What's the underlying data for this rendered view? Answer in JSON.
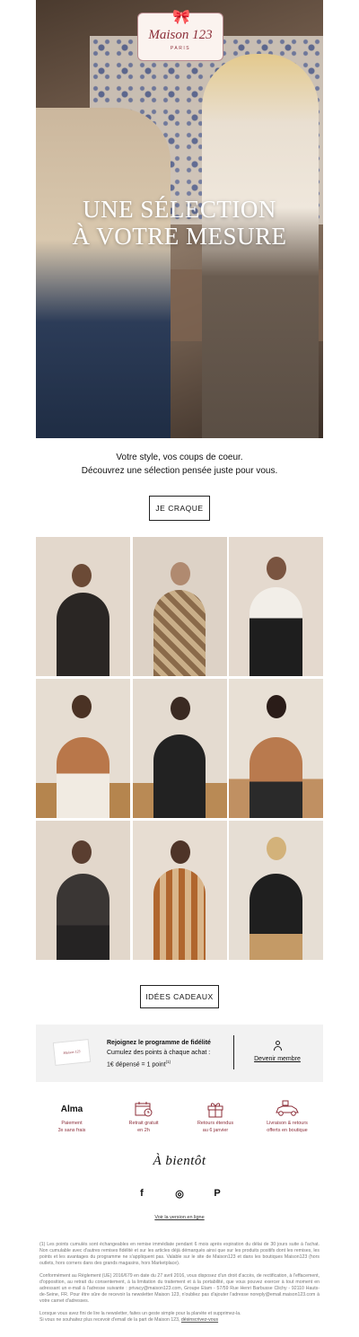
{
  "brand": {
    "name": "Maison 123",
    "city": "PARIS"
  },
  "hero": {
    "title_line1": "UNE SÉLECTION",
    "title_line2": "À VOTRE MESURE"
  },
  "intro": {
    "line1": "Votre style, vos coups de coeur.",
    "line2": "Découvrez une sélection pensée juste pour vous."
  },
  "cta_primary": "JE CRAQUE",
  "cta_secondary": "IDÉES CADEAUX",
  "loyalty": {
    "title": "Rejoignez le programme de fidélité",
    "line1": "Cumulez des points à chaque achat :",
    "line2": "1€ dépensé = 1 point",
    "footnote_mark": "(1)",
    "link": "Devenir membre"
  },
  "services": [
    {
      "icon": "alma-logo",
      "logo_text": "Alma",
      "line1": "Paiement",
      "line2": "3x sans frais"
    },
    {
      "icon": "calendar-clock-icon",
      "line1": "Retrait gratuit",
      "line2": "en 2h"
    },
    {
      "icon": "gift-icon",
      "line1": "Retours étendus",
      "line2": "au 6 janvier"
    },
    {
      "icon": "car-gift-icon",
      "line1": "Livraison & retours",
      "line2": "offerts en boutique"
    }
  ],
  "signoff": "À bientôt",
  "social": [
    {
      "icon": "facebook-icon",
      "glyph": "f"
    },
    {
      "icon": "instagram-icon",
      "glyph": "◎"
    },
    {
      "icon": "pinterest-icon",
      "glyph": "P"
    }
  ],
  "online_link": "Voir la version en ligne",
  "legal": {
    "p1": "(1) Les points cumulés sont échangeables en remise immédiate pendant 6 mois après expiration du délai de 30 jours suite à l'achat. Non cumulable avec d'autres remises fidélité et sur les articles déjà démarqués ainsi que sur les produits positifs dont les remises, les points et les avantages du programme ne s'appliquent pas. Valable sur le site de Maison123 et dans les boutiques Maison123 (hors outlets, hors corners dans des grands magasins, hors Marketplace).",
    "p2": "Conformément au Règlement (UE) 2016/679 en date du 27 avril 2016, vous disposez d'un droit d'accès, de rectification, à l'effacement, d'opposition, au retrait du consentement, à la limitation du traitement et à la portabilité, que vous pouvez exercer à tout moment en adressant un e-mail à l'adresse suivante : privacy@maison123.com, Groupe Etam - 57/59 Rue Henri Barbusse Clichy - 92110 Hauts-de-Seine, FR. Pour être sûre de recevoir la newsletter Maison 123, n'oubliez pas d'ajouter l'adresse noreply@email.maison123.com à votre carnet d'adresses.",
    "p3": "Lorsque vous avez fini de lire la newsletter, faites un geste simple pour la planète et supprimez-la.",
    "p4": "Si vous ne souhaitez plus recevoir d'email de la part de Maison 123,",
    "unsub": "désinscrivez-vous"
  },
  "colors": {
    "brand_red": "#8c2f3a",
    "panel_grey": "#f2f2f2"
  }
}
